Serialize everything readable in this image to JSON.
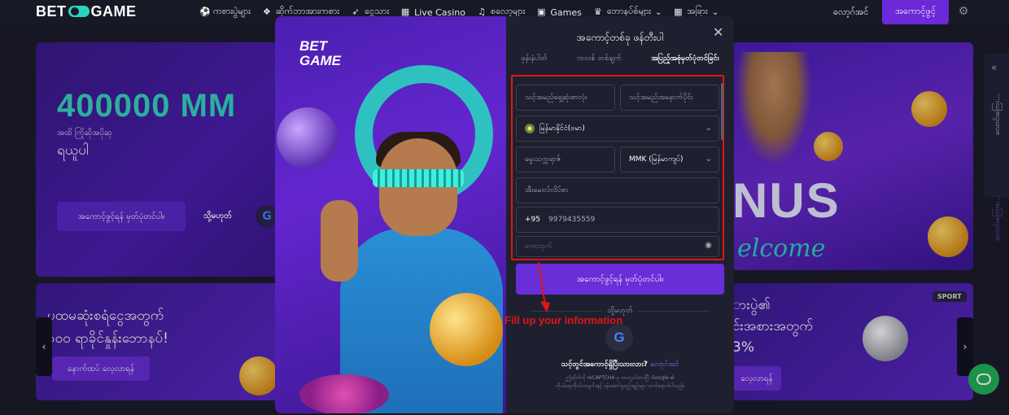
{
  "header": {
    "logo_left": "BET",
    "logo_right": "GAME",
    "nav": [
      {
        "icon": "soccer-ball-icon",
        "glyph": "⚽",
        "label": "ကစားပွဲများ"
      },
      {
        "icon": "dice-icon",
        "glyph": "❖",
        "label": "ဆိုက်ဘာအားကစား"
      },
      {
        "icon": "rocket-icon",
        "glyph": "➶",
        "label": "ငွေသား"
      },
      {
        "icon": "grid-icon",
        "glyph": "▦",
        "label": "Live Casino"
      },
      {
        "icon": "headphones-icon",
        "glyph": "♫",
        "label": "စလော့များ"
      },
      {
        "icon": "games-icon",
        "glyph": "▣",
        "label": "Games"
      },
      {
        "icon": "crown-icon",
        "glyph": "♛",
        "label": "ဘောနပ်စ်များ",
        "dropdown": true
      },
      {
        "icon": "apps-icon",
        "glyph": "▦",
        "label": "အခြား",
        "dropdown": true
      }
    ],
    "login_label": "လော့ဂ်အင်",
    "register_label": "အကောင့်ဖွင့်"
  },
  "banner_left": {
    "amount": "400000 MM",
    "subtitle": "အထိ ကြိုဆိုအပိုဆု",
    "subtitle2": "ရယူပါ",
    "button": "အကောင့်ဖွင့်ရန် မှတ်ပုံတင်ပါ။",
    "or": "သို့မဟုတ်"
  },
  "banner_right": {
    "bonus": "NUS",
    "welcome": "elcome"
  },
  "side_panel": {
    "label1": "လောင်းကြေး…",
    "label2": "လောင်းကြေးစ…"
  },
  "promo_left": {
    "line1": "ပထမဆုံးစရံငွေအတွက်",
    "line2": "၁၀၀ ရာခိုင်နှုန်းဘောနပ်!",
    "button": "နောက်ထပ် လေ့လာရန်"
  },
  "promo_right": {
    "badge": "SPORT",
    "line1": "ားပွဲ၏",
    "line2": "င်းအစားအတွက်",
    "line3": "3%",
    "button": "လေ့လာရန်"
  },
  "modal": {
    "art_logo_line1": "BET",
    "art_logo_line2": "GAME",
    "title": "အကောင့်တစ်ခု ဖန်တီးပါ",
    "tabs": [
      "ဖုန်းနံပါတ်",
      "ကလစ် တစ်ချက်",
      "အပြည့်အစုံမှတ်ပုံတင်ခြင်း"
    ],
    "active_tab": 2,
    "fields": {
      "first_name_placeholder": "သင့်အမည်ရှေ့ဆုံးစာလုံး",
      "last_name_placeholder": "သင့်အမည်အနောက်ပိုင်း",
      "country": "မြန်မာနိုင်ငံ(ဗမာ)",
      "city_placeholder": "မွေးသက္ကရာဇ်",
      "currency": "MMK (မြန်မာကျပ်)",
      "email_placeholder": "အီးမေးလ်လိပ်စာ",
      "phone_prefix": "+95",
      "phone_value": "9979435559",
      "password_placeholder": "စကားဝှက်"
    },
    "submit": "အကောင့်ဖွင့်ရန် မှတ်ပုံတင်ပါ။",
    "or": "သို့မဟုတ်",
    "have_account": "သင့်တွင်အကောင့်ရှိပြီးသားလား?",
    "login_link": "လော့ဂ်အင်",
    "captcha_line1": "ဤဆိုက်ကို reCAPTCHA မှ ကာကွယ်ထားပြီး Google ၏",
    "captcha_line2": "ကိုယ်ရေးကိုယ်တာမူဝါဒနှင့် ဝန်ဆောင်မှုစည်းမျဉ်းများ သက်ရောက်ပါသည်။"
  },
  "annotation": "Fill up your information",
  "colors": {
    "accent": "#6a2ed8",
    "teal": "#2ad3c0",
    "annotation_red": "#e01616",
    "chat_green": "#22b25a"
  }
}
